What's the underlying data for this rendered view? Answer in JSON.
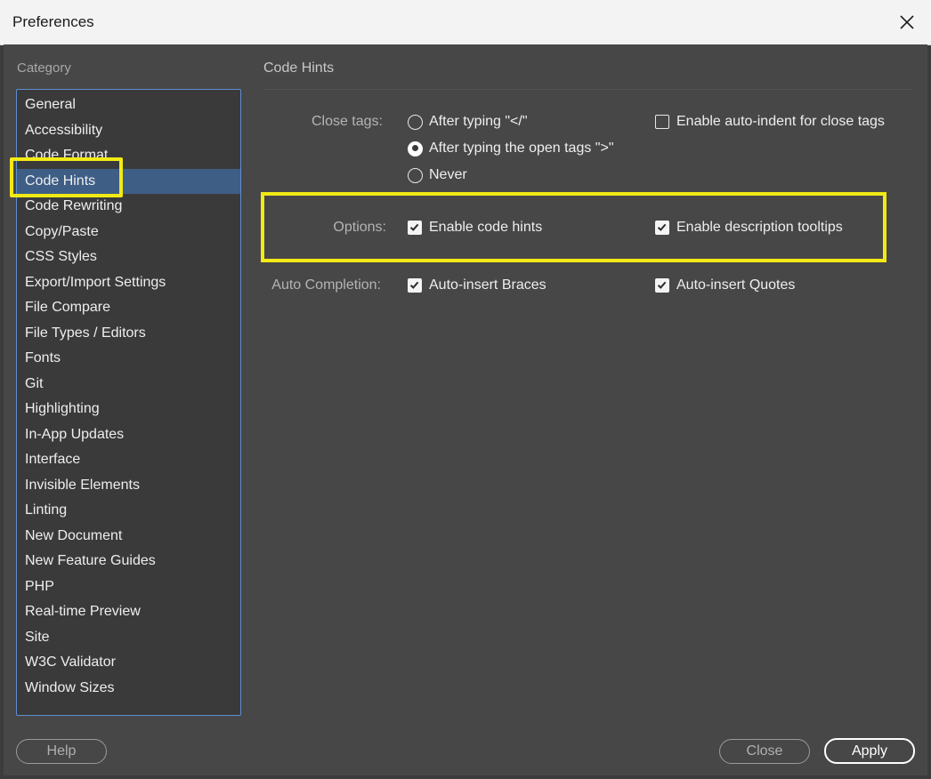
{
  "window": {
    "title": "Preferences",
    "close_icon": "close-icon"
  },
  "category": {
    "header": "Category",
    "items": [
      "General",
      "Accessibility",
      "Code Format",
      "Code Hints",
      "Code Rewriting",
      "Copy/Paste",
      "CSS Styles",
      "Export/Import Settings",
      "File Compare",
      "File Types / Editors",
      "Fonts",
      "Git",
      "Highlighting",
      "In-App Updates",
      "Interface",
      "Invisible Elements",
      "Linting",
      "New Document",
      "New Feature Guides",
      "PHP",
      "Real-time Preview",
      "Site",
      "W3C Validator",
      "Window Sizes"
    ],
    "selected": "Code Hints"
  },
  "pane": {
    "title": "Code Hints",
    "close_tags": {
      "label": "Close tags:",
      "options": [
        {
          "label": "After typing \"</\"",
          "selected": false
        },
        {
          "label": "After typing the open tags \">\"",
          "selected": true
        },
        {
          "label": "Never",
          "selected": false
        }
      ],
      "auto_indent": {
        "label": "Enable auto-indent for close tags",
        "checked": false
      }
    },
    "options": {
      "label": "Options:",
      "code_hints": {
        "label": "Enable code hints",
        "checked": true
      },
      "description_tooltips": {
        "label": "Enable description tooltips",
        "checked": true
      }
    },
    "auto_completion": {
      "label": "Auto Completion:",
      "braces": {
        "label": "Auto-insert Braces",
        "checked": true
      },
      "quotes": {
        "label": "Auto-insert Quotes",
        "checked": true
      }
    }
  },
  "buttons": {
    "help": "Help",
    "close": "Close",
    "apply": "Apply"
  },
  "colors": {
    "dialog_bg": "#474747",
    "list_bg": "#3a3a3a",
    "selected_bg": "#3f5e86",
    "highlight": "#f2ea14",
    "list_border": "#5d8fcf"
  }
}
